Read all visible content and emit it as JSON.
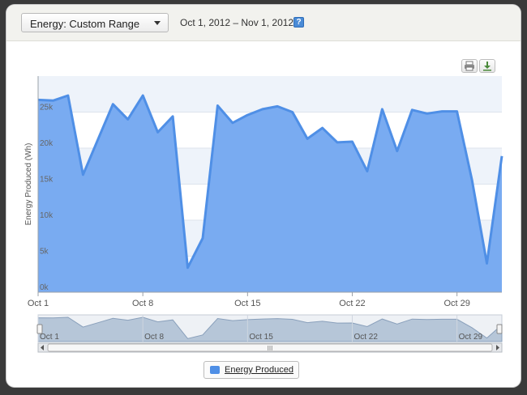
{
  "header": {
    "range_select_label": "Energy: Custom Range",
    "date_range": "Oct 1, 2012 – Nov 1, 2012",
    "help_label": "?"
  },
  "toolbar": {
    "print_icon": "printer-icon",
    "download_icon": "download-icon"
  },
  "colors": {
    "series_fill": "#79abf1",
    "series_line": "#4f8fe6",
    "band": "#eef3fa",
    "navigator_fill": "#b6c6d8"
  },
  "chart_data": {
    "type": "area",
    "ylabel": "Energy Produced (Wh)",
    "ylim": [
      0,
      30000
    ],
    "y_ticks": [
      "0k",
      "5k",
      "10k",
      "15k",
      "20k",
      "25k"
    ],
    "x_tick_labels": [
      "Oct 1",
      "Oct 8",
      "Oct 15",
      "Oct 22",
      "Oct 29"
    ],
    "navigator_labels": [
      "Oct 1",
      "Oct 8",
      "Oct 15",
      "Oct 22",
      "Oct 29"
    ],
    "scrollbar_grip": "III",
    "series": [
      {
        "name": "Energy Produced",
        "values": [
          26700,
          26600,
          27300,
          16300,
          21200,
          26100,
          24000,
          27300,
          22200,
          24400,
          3400,
          7500,
          25900,
          23500,
          24600,
          25400,
          25800,
          25000,
          21300,
          22800,
          20800,
          20900,
          16800,
          25400,
          19600,
          25300,
          24800,
          25100,
          25100,
          15600,
          4000,
          18900
        ]
      }
    ]
  },
  "legend": {
    "label": "Energy Produced"
  }
}
